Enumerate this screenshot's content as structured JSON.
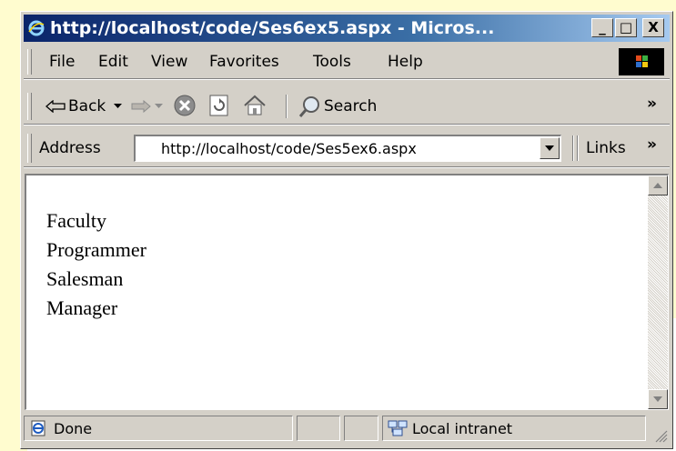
{
  "window": {
    "title": "http://localhost/code/Ses6ex5.aspx - Micros...",
    "caption_buttons": {
      "minimize": "_",
      "maximize": "□",
      "close": "X"
    }
  },
  "menu": {
    "items": [
      {
        "label": "File"
      },
      {
        "label": "Edit"
      },
      {
        "label": "View"
      },
      {
        "label": "Favorites"
      },
      {
        "label": "Tools"
      },
      {
        "label": "Help"
      }
    ]
  },
  "toolbar": {
    "back_label": "Back",
    "search_label": "Search",
    "chevron": "»",
    "icons": [
      "back-arrow-icon",
      "forward-arrow-icon",
      "stop-icon",
      "refresh-icon",
      "home-icon",
      "search-icon"
    ]
  },
  "address_bar": {
    "label": "Address",
    "value": "http://localhost/code/Ses5ex6.aspx",
    "links_label": "Links",
    "chevron": "»"
  },
  "content": {
    "items": [
      "Faculty",
      "Programmer",
      "Salesman",
      "Manager"
    ]
  },
  "status_bar": {
    "status": "Done",
    "zone": "Local intranet"
  },
  "colors": {
    "slide_background": "#fffccf",
    "chrome": "#d4d0c8",
    "title_bar_start": "#0a246a",
    "title_bar_end": "#a6caf0"
  }
}
